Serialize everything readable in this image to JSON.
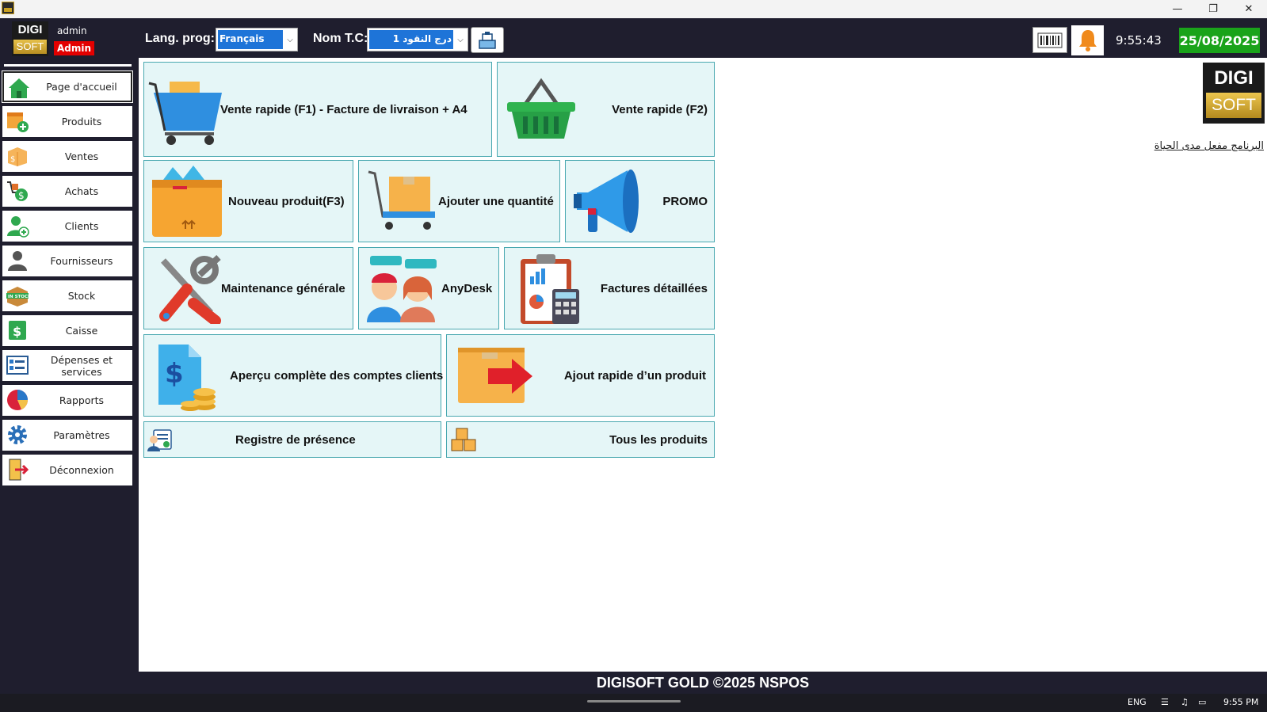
{
  "header": {
    "user_name": "admin",
    "user_role": "Admin",
    "lang_label": "Lang. prog:",
    "lang_value": "Français",
    "cash_label": "Nom T.C:",
    "cash_value": "درج النقود 1",
    "time": "9:55:43",
    "date": "25/08/2025"
  },
  "logo": {
    "line1": "DIGI",
    "line2": "SOFT"
  },
  "sidebar": {
    "items": [
      {
        "label": "Page d'accueil",
        "icon": "home-icon"
      },
      {
        "label": "Produits",
        "icon": "products-icon"
      },
      {
        "label": "Ventes",
        "icon": "sales-box-icon"
      },
      {
        "label": "Achats",
        "icon": "purchases-cart-icon"
      },
      {
        "label": "Clients",
        "icon": "add-client-icon"
      },
      {
        "label": "Fournisseurs",
        "icon": "supplier-person-icon"
      },
      {
        "label": "Stock",
        "icon": "in-stock-icon"
      },
      {
        "label": "Caisse",
        "icon": "cash-dollar-icon"
      },
      {
        "label": "Dépenses et services",
        "icon": "expenses-list-icon"
      },
      {
        "label": "Rapports",
        "icon": "pie-chart-icon"
      },
      {
        "label": "Paramètres",
        "icon": "gear-icon"
      },
      {
        "label": "Déconnexion",
        "icon": "logout-door-icon"
      }
    ]
  },
  "tiles": {
    "quick_sale_f1": "Vente rapide (F1) - Facture de livraison + A4",
    "quick_sale_f2": "Vente rapide (F2)",
    "new_product": "Nouveau produit(F3)",
    "add_quantity": "Ajouter une quantité",
    "promo": "PROMO",
    "maintenance": "Maintenance générale",
    "anydesk": "AnyDesk",
    "detailed_invoices": "Factures détaillées",
    "client_accounts": "Aperçu  complète des comptes clients",
    "quick_add_product": "Ajout rapide d’un produit",
    "attendance": "Registre de présence",
    "all_products": "Tous les produits"
  },
  "license_text": "البرنامج مفعل مدى الحياة",
  "footer": "DIGISOFT GOLD ©2025 NSPOS",
  "taskbar": {
    "lang": "ENG",
    "time": "9:55 PM"
  },
  "colors": {
    "bg_dark": "#1f1e2e",
    "tile_bg": "#e5f6f7",
    "tile_border": "#49a8b0",
    "date_green": "#1aa31a",
    "role_red": "#e30000"
  }
}
